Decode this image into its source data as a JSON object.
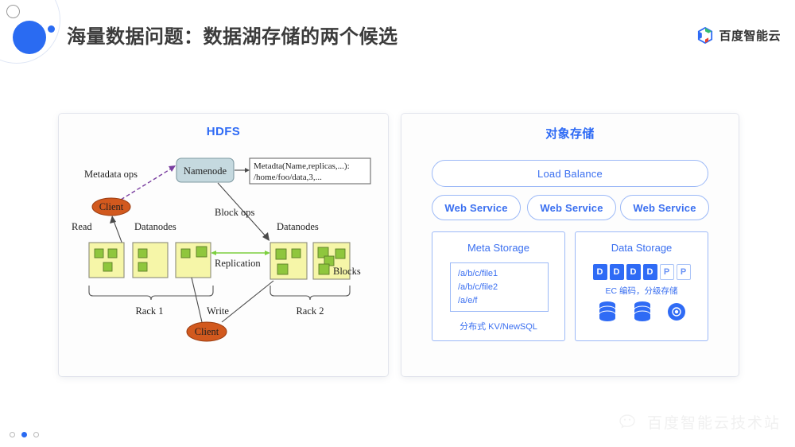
{
  "header": {
    "title": "海量数据问题：数据湖存储的两个候选",
    "brand_text": "百度智能云",
    "brand_icon": "baidu-cloud-logo-icon"
  },
  "hdfs": {
    "title": "HDFS",
    "namenode": "Namenode",
    "metadata_box_line1": "Metadta(Name,replicas,...):",
    "metadata_box_line2": "/home/foo/data,3,...",
    "metadata_ops": "Metadata ops",
    "block_ops": "Block ops",
    "client_top": "Client",
    "client_bottom": "Client",
    "read": "Read",
    "write": "Write",
    "replication": "Replication",
    "datanodes_left": "Datanodes",
    "datanodes_right": "Datanodes",
    "blocks": "Blocks",
    "rack1": "Rack 1",
    "rack2": "Rack 2"
  },
  "object_storage": {
    "title": "对象存储",
    "load_balance": "Load Balance",
    "web_services": [
      "Web Service",
      "Web Service",
      "Web Service"
    ],
    "meta_storage": {
      "title": "Meta Storage",
      "paths": [
        "/a/b/c/file1",
        "/a/b/c/file2",
        "/a/e/f"
      ],
      "footer": "分布式 KV/NewSQL"
    },
    "data_storage": {
      "title": "Data Storage",
      "ec_cells": [
        {
          "label": "D",
          "kind": "data"
        },
        {
          "label": "D",
          "kind": "data"
        },
        {
          "label": "D",
          "kind": "data"
        },
        {
          "label": "D",
          "kind": "data"
        },
        {
          "label": "P",
          "kind": "parity"
        },
        {
          "label": "P",
          "kind": "parity"
        }
      ],
      "note": "EC 编码，分级存储",
      "disk_icons": [
        "database-cylinder-icon",
        "database-cylinder-icon",
        "optical-disc-icon"
      ]
    }
  },
  "footer": {
    "dots": [
      false,
      true,
      false
    ],
    "watermark_text": "百度智能云技术站",
    "watermark_icon": "wechat-icon"
  },
  "colors": {
    "accent_blue": "#2f6bf5",
    "pill_border": "#9cb9f7",
    "datanode_fill": "#f6f6a8",
    "block_green": "#8fc63d",
    "client_orange": "#d2591e",
    "namenode_fill": "#c5d9df"
  }
}
